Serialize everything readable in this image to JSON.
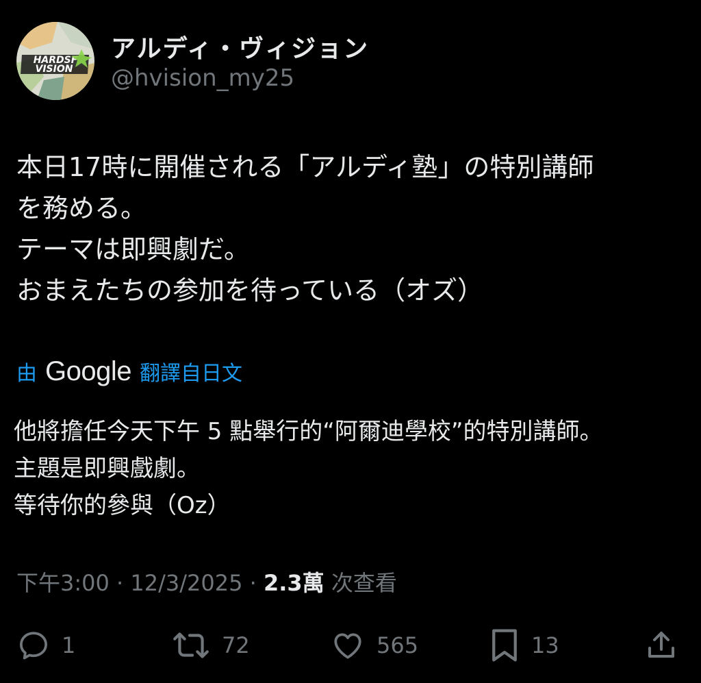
{
  "author": {
    "display_name": "アルディ・ヴィジョン",
    "handle": "@hvision_my25",
    "avatar_text_line1": "HARDSF",
    "avatar_text_line2": "VISION"
  },
  "tweet": {
    "text_lines": [
      "本日17時に開催される「アルディ塾」の特別講師",
      "を務める。",
      "テーマは即興劇だ。",
      "おまえたちの参加を待っている（オズ）"
    ]
  },
  "translation": {
    "by_label": "由",
    "provider": "Google",
    "from_label": "翻譯自日文",
    "text_lines": [
      "他將擔任今天下午 5 點舉行的“阿爾迪學校”的特別講師。",
      "主題是即興戲劇。",
      "等待你的參與（Oz）"
    ]
  },
  "meta": {
    "time": "下午3:00",
    "separator1": " · ",
    "date": "12/3/2025",
    "separator2": " · ",
    "views_count": "2.3萬",
    "views_label": " 次查看"
  },
  "actions": {
    "reply_icon": "reply-icon",
    "reply_count": "1",
    "repost_icon": "repost-icon",
    "repost_count": "72",
    "like_icon": "heart-icon",
    "like_count": "565",
    "bookmark_icon": "bookmark-icon",
    "bookmark_count": "13",
    "share_icon": "share-icon"
  },
  "colors": {
    "background": "#000000",
    "primary_text": "#e7e9ea",
    "secondary_text": "#71767b",
    "link_blue": "#1d9bf0"
  }
}
